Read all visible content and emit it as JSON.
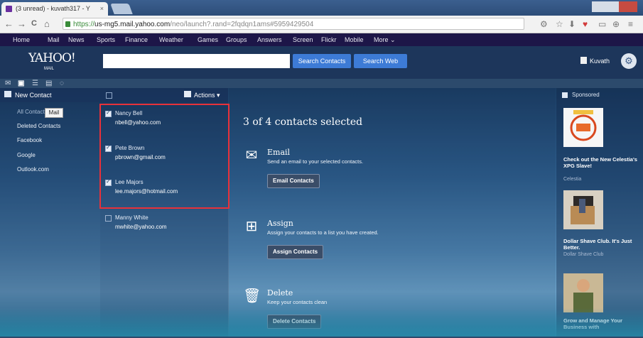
{
  "browser": {
    "tab_title": "(3 unread) - kuvath317 - Y",
    "tab_close": "×",
    "url_scheme": "https://",
    "url_host": "us-mg5.mail.yahoo.com",
    "url_rest": "/neo/launch?.rand=2fqdqn1ams#5959429504",
    "back": "←",
    "forward": "→",
    "reload": "C",
    "home": "⌂"
  },
  "ynav": {
    "items": [
      "Home",
      "Mail",
      "News",
      "Sports",
      "Finance",
      "Weather",
      "Games",
      "Groups",
      "Answers",
      "Screen",
      "Flickr",
      "Mobile",
      "More ⌄"
    ]
  },
  "header": {
    "logo": "YAHOO!",
    "logo_sub": "MAIL",
    "search_placeholder": "",
    "search_contacts_label": "Search Contacts",
    "search_web_label": "Search Web",
    "user_name": "Kuvath"
  },
  "left_nav": {
    "new_contact_label": "New Contact",
    "items": [
      "All Contacts",
      "Deleted Contacts",
      "Facebook",
      "Google",
      "Outlook.com"
    ],
    "mail_badge": "Mail"
  },
  "contacts": {
    "actions_label": "Actions ▾",
    "list": [
      {
        "name": "Nancy Bell",
        "email": "nbell@yahoo.com",
        "checked": true
      },
      {
        "name": "Pete Brown",
        "email": "pbrown@gmail.com",
        "checked": true
      },
      {
        "name": "Lee Majors",
        "email": "lee.majors@hotmail.com",
        "checked": true
      },
      {
        "name": "Manny White",
        "email": "mwhite@yahoo.com",
        "checked": false
      }
    ]
  },
  "detail": {
    "selected_title": "3 of 4 contacts selected",
    "email": {
      "title": "Email",
      "desc": "Send an email to your selected contacts.",
      "button": "Email Contacts"
    },
    "assign": {
      "title": "Assign",
      "desc": "Assign your contacts to a list you have created.",
      "button": "Assign Contacts"
    },
    "delete": {
      "title": "Delete",
      "desc": "Keep your contacts clean",
      "button": "Delete Contacts"
    }
  },
  "rail": {
    "sponsored_label": "Sponsored",
    "ads": [
      {
        "title": "Check out the New Celestia's XPG Slave!",
        "sub": "Celestia"
      },
      {
        "title": "Dollar Shave Club. It's Just Better.",
        "sub": "Dollar Shave Club"
      },
      {
        "title": "Grow and Manage Your Business with",
        "sub": ""
      }
    ]
  },
  "colors": {
    "accent_blue": "#3d7bd6",
    "selection_border": "#e8313a",
    "nav_bg": "#1d1648"
  }
}
